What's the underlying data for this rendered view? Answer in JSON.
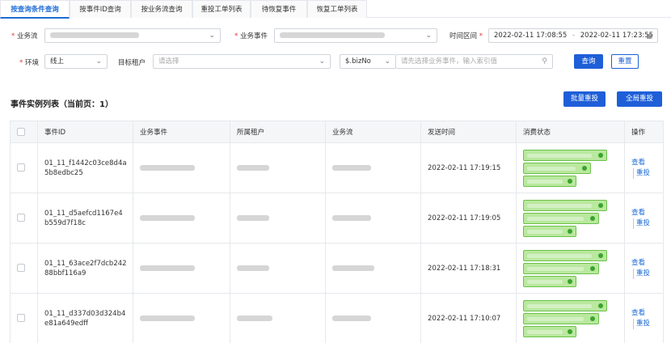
{
  "tabs": [
    {
      "label": "按查询条件查询",
      "active": true
    },
    {
      "label": "按事件ID查询",
      "active": false
    },
    {
      "label": "按业务流查询",
      "active": false
    },
    {
      "label": "重投工单列表",
      "active": false
    },
    {
      "label": "待恢复事件",
      "active": false
    },
    {
      "label": "恢复工单列表",
      "active": false
    }
  ],
  "filters": {
    "biz_flow_label": "业务流",
    "biz_event_label": "业务事件",
    "time_range_label": "时间区间",
    "time_start": "2022-02-11 17:08:55",
    "time_separator": "-",
    "time_end": "2022-02-11 17:23:55",
    "env_label": "环境",
    "env_value": "线上",
    "tenant_label": "目标租户",
    "tenant_placeholder": "请选择",
    "key_value": "$.bizNo",
    "key_placeholder": "请先选择业务事件，输入索引值",
    "query_label": "查询",
    "reset_label": "重置"
  },
  "list": {
    "title": "事件实例列表（当前页：1）",
    "batch_retry_label": "批量重投",
    "global_retry_label": "全局重投"
  },
  "table": {
    "columns": [
      "",
      "事件ID",
      "业务事件",
      "所属租户",
      "业务流",
      "发送时间",
      "消费状态",
      "操作"
    ],
    "rows": [
      {
        "event_id": "01_11_f1442c03ce8d4a5b8edbc25",
        "send_time": "2022-02-11 17:19:15"
      },
      {
        "event_id": "01_11_d5aefcd1167e4b559d7f18c",
        "send_time": "2022-02-11 17:19:05"
      },
      {
        "event_id": "01_11_63ace2f7dcb24288bbf116a9",
        "send_time": "2022-02-11 17:18:31"
      },
      {
        "event_id": "01_11_d337d03d324b4e81a649edff",
        "send_time": "2022-02-11 17:10:07"
      }
    ],
    "view_label": "查看",
    "retry_label": "重投"
  },
  "icons": {
    "select_arrow": "chevron-down-icon",
    "search": "search-icon",
    "calendar": "calendar-icon"
  },
  "colors": {
    "accent": "#1e5fd8",
    "success_fill": "#b9e89e",
    "success_border": "#6cc24a"
  }
}
